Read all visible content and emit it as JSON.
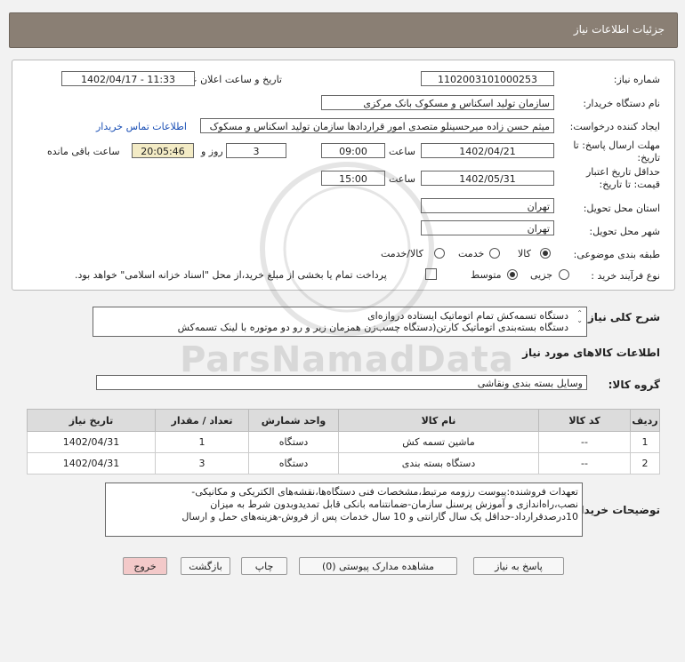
{
  "header": {
    "title": "جزئیات اطلاعات نیاز"
  },
  "form": {
    "need_number_label": "شماره نیاز:",
    "need_number": "1102003101000253",
    "announce_label": "تاریخ و ساعت اعلان عمومی:",
    "announce_value": "1402/04/17 - 11:33",
    "buyer_org_label": "نام دستگاه خریدار:",
    "buyer_org": "سازمان تولید اسکناس و مسکوک بانک مرکزی",
    "creator_label": "ایجاد کننده درخواست:",
    "creator": "میثم حسن زاده میرحسینلو متصدی امور قراردادها سازمان تولید اسکناس و مسکوک",
    "contact_link": "اطلاعات تماس خریدار",
    "deadline_label_1": "مهلت ارسال پاسخ: تا",
    "deadline_label_2": "تاریخ:",
    "deadline_date": "1402/04/21",
    "hour_label": "ساعت",
    "deadline_time": "09:00",
    "days_value": "3",
    "days_label": "روز و",
    "remaining_time": "20:05:46",
    "remaining_label": "ساعت باقی مانده",
    "validity_label_1": "حداقل تاریخ اعتبار",
    "validity_label_2": "قیمت: تا تاریخ:",
    "validity_date": "1402/05/31",
    "validity_hour_label": "ساعت",
    "validity_time": "15:00",
    "province_label": "استان محل تحویل:",
    "province": "تهران",
    "city_label": "شهر محل تحویل:",
    "city": "تهران",
    "category_label": "طبقه بندی موضوعی:",
    "category_options": [
      "کالا",
      "خدمت",
      "کالا/خدمت"
    ],
    "purchase_type_label": "نوع فرآیند خرید :",
    "purchase_options": [
      "جزیی",
      "متوسط"
    ],
    "payment_note": "پرداخت تمام یا بخشی از مبلغ خرید،از محل \"اسناد خزانه اسلامی\" خواهد بود."
  },
  "description": {
    "label": "شرح کلی نیاز:",
    "lines": [
      "دستگاه تسمه‌کش تمام اتوماتیک ایستاده دروازه‌ای",
      "دستگاه بسته‌بندی اتوماتیک کارتن(دستگاه چسب‌زن همزمان زیر و رو دو موتوره با لینک تسمه‌کش"
    ]
  },
  "goods": {
    "section_title": "اطلاعات کالاهای مورد نیاز",
    "group_label": "گروه کالا:",
    "group_value": "وسایل بسته بندی  ونقاشی",
    "columns": [
      "ردیف",
      "کد کالا",
      "نام کالا",
      "واحد شمارش",
      "تعداد / مقدار",
      "تاریخ نیاز"
    ],
    "rows": [
      [
        "1",
        "--",
        "ماشین تسمه کش",
        "دستگاه",
        "1",
        "1402/04/31"
      ],
      [
        "2",
        "--",
        "دستگاه بسته بندی",
        "دستگاه",
        "3",
        "1402/04/31"
      ]
    ]
  },
  "buyer_notes": {
    "label": "توضیحات خریدار:",
    "lines": [
      "تعهدات فروشنده:پیوست رزومه مرتبط،مشخصات فنی دستگاه‌ها،نقشه‌های الکتریکی و مکانیکی-",
      "نصب،راه‌اندازی و آموزش پرسنل سازمان-ضمانتنامه بانکی قابل تمدیدوبدون شرط به میزان",
      "10درصدقرارداد-حداقل یک سال گارانتی و 10 سال خدمات پس از فروش-هزینه‌های حمل و ارسال"
    ]
  },
  "buttons": {
    "reply": "پاسخ به نیاز",
    "attachments": "مشاهده مدارک پیوستی (0)",
    "print": "چاپ",
    "back": "بازگشت",
    "exit": "خروج"
  },
  "watermark": {
    "brand": "ParsNamadData"
  },
  "colors": {
    "header_bg": "#8a7f74",
    "link": "#1a4fb5",
    "remaining_bg": "#f3ebc5",
    "exit_bg": "#f3c9c9"
  }
}
